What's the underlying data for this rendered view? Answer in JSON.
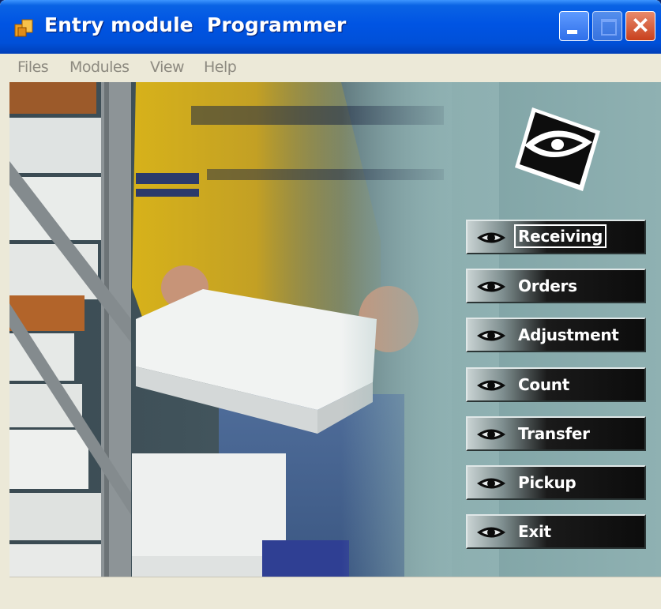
{
  "window": {
    "title": "Entry module  Programmer",
    "controls": {
      "minimize": "minimize-icon",
      "maximize": "maximize-icon",
      "close": "close-icon"
    }
  },
  "menu": {
    "items": [
      "Files",
      "Modules",
      "View",
      "Help"
    ]
  },
  "modules": {
    "buttons": [
      {
        "label": "Receiving",
        "focused": true
      },
      {
        "label": "Orders"
      },
      {
        "label": "Adjustment"
      },
      {
        "label": "Count"
      },
      {
        "label": "Transfer"
      },
      {
        "label": "Pickup"
      },
      {
        "label": "Exit"
      }
    ]
  },
  "icons": {
    "app": "app-icon",
    "logo": "eye-logo-icon",
    "button": "eye-icon"
  },
  "colors": {
    "titlebar": "#0054e3",
    "background": "#6d9192",
    "button": "#0c0c0c",
    "button_text": "#ffffff",
    "menu_text": "#8d8a80"
  }
}
